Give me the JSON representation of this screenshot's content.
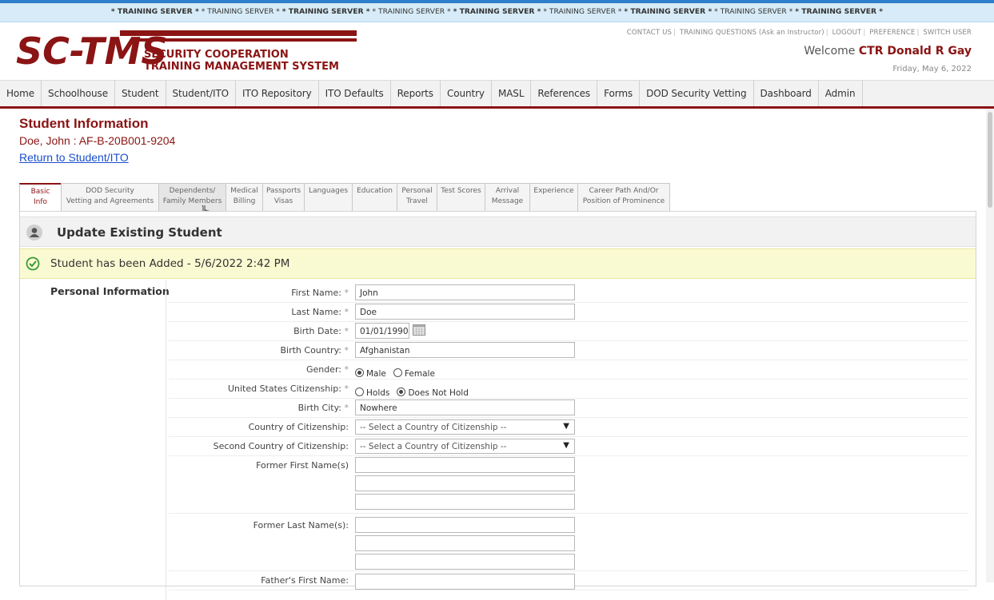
{
  "banner": {
    "text_bold": "* TRAINING SERVER *",
    "text_plain": "* TRAINING SERVER *"
  },
  "header": {
    "logo_text_1": "SECURITY COOPERATION",
    "logo_text_2": "TRAINING MANAGEMENT SYSTEM",
    "logo_letters": "SC-TMS",
    "top_links": [
      "CONTACT US",
      "TRAINING QUESTIONS (Ask an Instructor)",
      "LOGOUT",
      "PREFERENCE",
      "SWITCH USER"
    ],
    "welcome_prefix": "Welcome ",
    "user_name": "CTR Donald R Gay",
    "date": "Friday, May 6, 2022"
  },
  "nav": [
    "Home",
    "Schoolhouse",
    "Student",
    "Student/ITO",
    "ITO Repository",
    "ITO Defaults",
    "Reports",
    "Country",
    "MASL",
    "References",
    "Forms",
    "DOD Security Vetting",
    "Dashboard",
    "Admin"
  ],
  "page": {
    "title": "Student Information",
    "subtitle": "Doe, John : AF-B-20B001-9204",
    "return_link": "Return to Student/ITO"
  },
  "tabs": [
    {
      "line1": "Basic Info",
      "line2": ""
    },
    {
      "line1": "DOD Security",
      "line2": "Vetting and Agreements"
    },
    {
      "line1": "Dependents/",
      "line2": "Family Members"
    },
    {
      "line1": "Medical",
      "line2": "Billing"
    },
    {
      "line1": "Passports",
      "line2": "Visas"
    },
    {
      "line1": "Languages",
      "line2": ""
    },
    {
      "line1": "Education",
      "line2": ""
    },
    {
      "line1": "Personal",
      "line2": "Travel"
    },
    {
      "line1": "Test Scores",
      "line2": ""
    },
    {
      "line1": "Arrival",
      "line2": "Message"
    },
    {
      "line1": "Experience",
      "line2": ""
    },
    {
      "line1": "Career Path And/Or",
      "line2": "Position of Prominence"
    }
  ],
  "panel": {
    "title": "Update Existing Student",
    "alert": "Student has been Added - 5/6/2022 2:42 PM",
    "section": "Personal Information"
  },
  "form": {
    "first_name": {
      "label": "First Name:",
      "value": "John"
    },
    "last_name": {
      "label": "Last Name:",
      "value": "Doe"
    },
    "birth_date": {
      "label": "Birth Date:",
      "value": "01/01/1990"
    },
    "birth_country": {
      "label": "Birth Country:",
      "value": "Afghanistan"
    },
    "gender": {
      "label": "Gender:",
      "option1": "Male",
      "option2": "Female"
    },
    "citizenship": {
      "label": "United States Citizenship:",
      "option1": "Holds",
      "option2": "Does Not Hold"
    },
    "birth_city": {
      "label": "Birth City:",
      "value": "Nowhere"
    },
    "country_citizenship": {
      "label": "Country of Citizenship:",
      "value": "-- Select a Country of Citizenship --"
    },
    "second_country": {
      "label": "Second Country of Citizenship:",
      "value": "-- Select a Country of Citizenship --"
    },
    "former_first": {
      "label": "Former First Name(s)"
    },
    "former_last": {
      "label": "Former Last Name(s):"
    },
    "father_first": {
      "label": "Father's First Name:"
    },
    "required_mark": "*"
  },
  "colors": {
    "brand": "#8b1414",
    "banner": "#d7ecf8",
    "alert": "#fafad2",
    "link": "#1a4fcc"
  }
}
